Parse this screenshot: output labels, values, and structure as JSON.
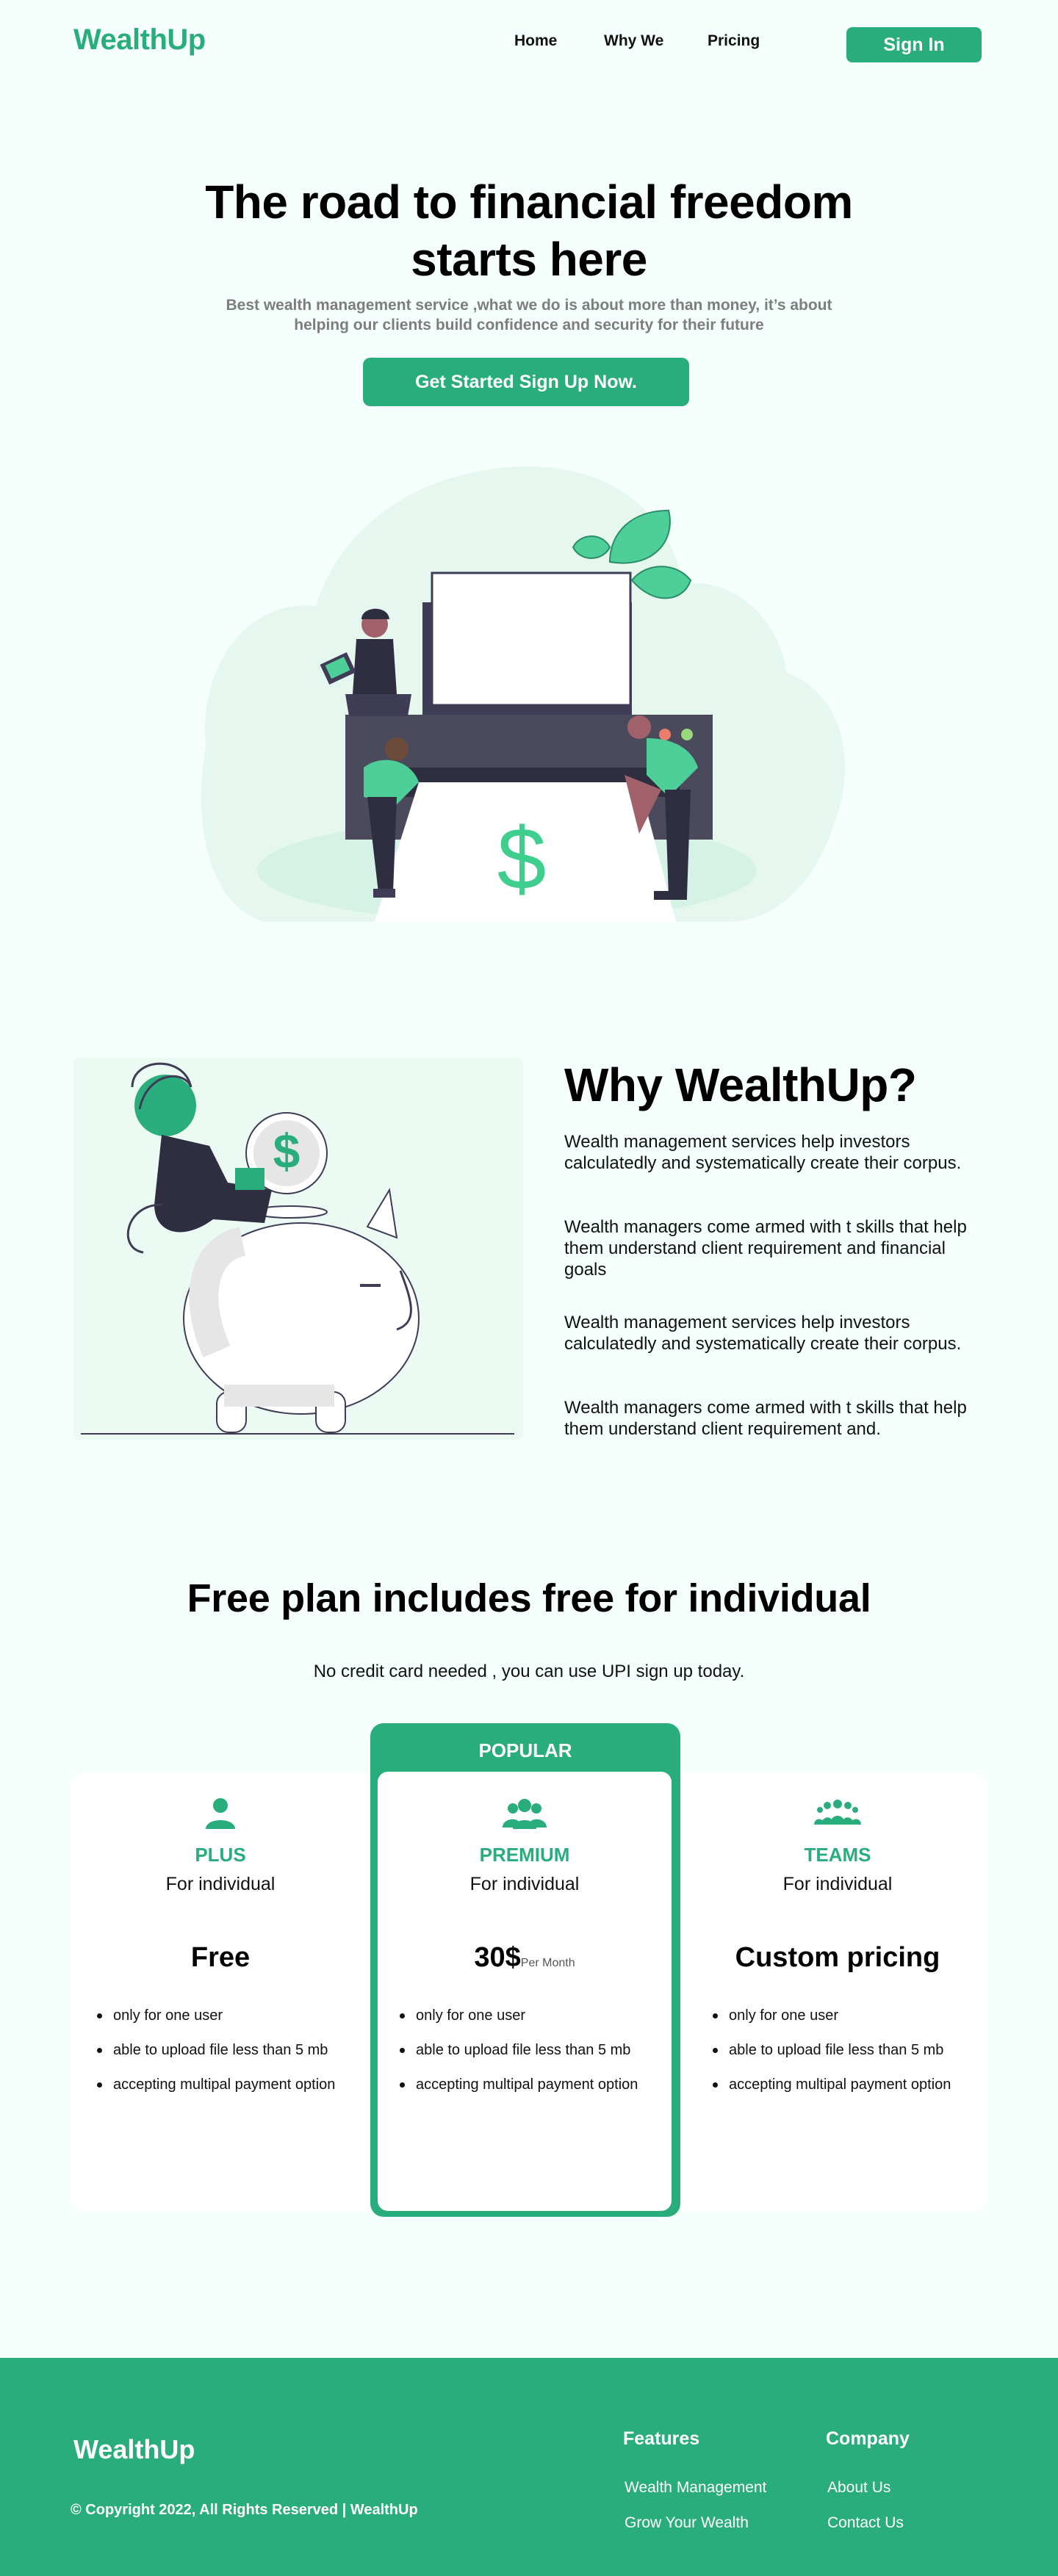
{
  "nav": {
    "logo": "WealthUp",
    "links": [
      "Home",
      "Why We",
      "Pricing"
    ],
    "signin_label": "Sign In"
  },
  "hero": {
    "title_line1": "The road to financial freedom",
    "title_line2": "starts here",
    "subtitle_line1": "Best wealth management service ,what we do is about more than money, it’s about",
    "subtitle_line2": "helping our clients build confidence and security for their future",
    "cta_label": "Get Started Sign Up Now."
  },
  "why": {
    "title": "Why WealthUp?",
    "paragraphs": [
      "Wealth management services help investors calculatedly and systematically create their corpus.",
      "Wealth managers come armed with t skills that help them understand client requirement and financial goals",
      "Wealth management services help investors calculatedly and systematically create their corpus.",
      "Wealth managers come armed with t skills that help them understand client requirement and."
    ]
  },
  "pricing": {
    "title": "Free plan includes free for individual",
    "subtitle": "No credit card  needed , you can  use UPI sign up today.",
    "popular_label": "POPULAR",
    "plans": [
      {
        "icon": "user-icon",
        "name": "PLUS",
        "for": "For individual",
        "price": "Free",
        "per": "",
        "features": [
          "only for one user",
          "able to upload file less than 5 mb",
          "accepting multipal payment option"
        ]
      },
      {
        "icon": "users-group-icon",
        "name": "PREMIUM",
        "for": "For individual",
        "price": "30$",
        "per": "Per Month",
        "features": [
          "only for one user",
          "able to upload file less than 5 mb",
          "accepting multipal payment option"
        ]
      },
      {
        "icon": "team-icon",
        "name": "TEAMS",
        "for": "For individual",
        "price": "Custom pricing",
        "per": "",
        "features": [
          "only for one user",
          "able to upload file less than 5 mb",
          "accepting multipal payment option"
        ]
      }
    ]
  },
  "footer": {
    "logo": "WealthUp",
    "copyright": "© Copyright 2022, All Rights Reserved | WealthUp",
    "features_heading": "Features",
    "features_links": [
      "Wealth Management",
      "Grow Your Wealth"
    ],
    "company_heading": "Company",
    "company_links": [
      "About Us",
      "Contact Us"
    ]
  },
  "colors": {
    "accent": "#2aad7d",
    "background": "#f5fffb",
    "dark": "#3f3d56"
  }
}
